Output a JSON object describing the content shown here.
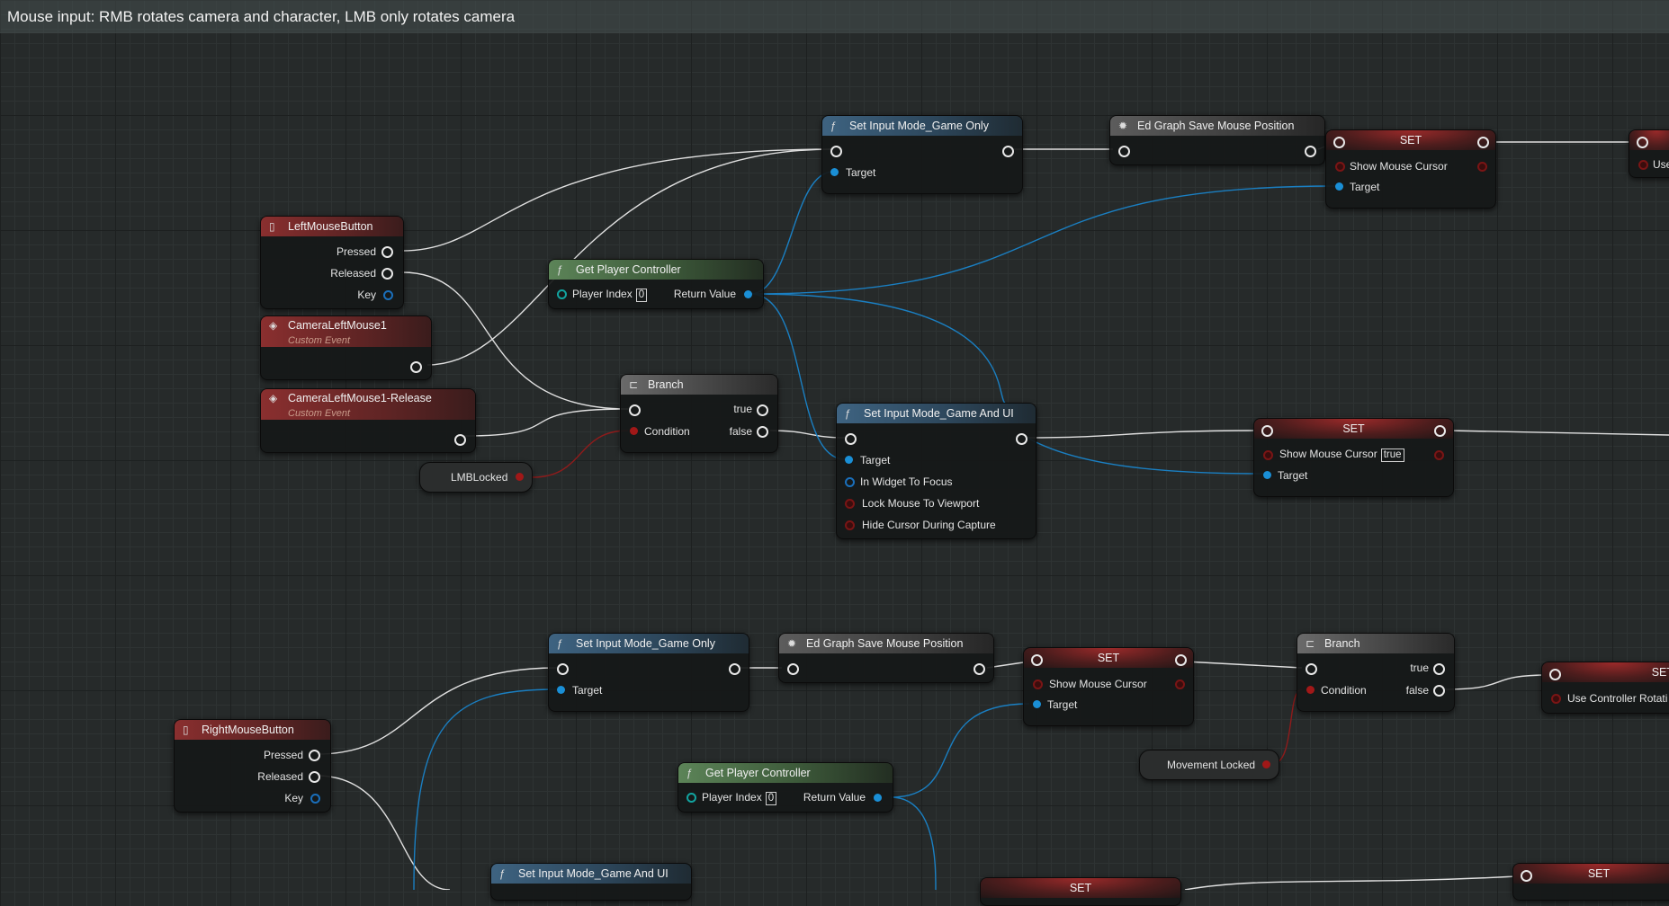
{
  "comment": "Mouse input: RMB rotates camera and character, LMB only rotates camera",
  "nodes": {
    "si_go_1": {
      "title": "Set Input Mode_Game Only",
      "target": "Target"
    },
    "ed_save_1": {
      "title": "Ed Graph Save Mouse Position"
    },
    "set_1": {
      "title": "SET",
      "var": "Show Mouse Cursor",
      "target": "Target"
    },
    "set_1b": {
      "label": "Use"
    },
    "lmb": {
      "title": "LeftMouseButton",
      "pressed": "Pressed",
      "released": "Released",
      "key": "Key"
    },
    "gpc_1": {
      "title": "Get Player Controller",
      "index_label": "Player Index",
      "index_value": "0",
      "return": "Return Value"
    },
    "cam_evt": {
      "title": "CameraLeftMouse1",
      "subtitle": "Custom Event"
    },
    "cam_rel": {
      "title": "CameraLeftMouse1-Release",
      "subtitle": "Custom Event"
    },
    "branch_1": {
      "title": "Branch",
      "true": "true",
      "false": "false",
      "condition": "Condition"
    },
    "lmb_locked": {
      "label": "LMBLocked"
    },
    "si_gui_1": {
      "title": "Set Input Mode_Game And UI",
      "target": "Target",
      "widget": "In Widget To Focus",
      "lock": "Lock Mouse To Viewport",
      "hide": "Hide Cursor During Capture"
    },
    "set_2": {
      "title": "SET",
      "var": "Show Mouse Cursor",
      "value": "true",
      "target": "Target"
    },
    "si_go_2": {
      "title": "Set Input Mode_Game Only",
      "target": "Target"
    },
    "ed_save_2": {
      "title": "Ed Graph Save Mouse Position"
    },
    "set_3": {
      "title": "SET",
      "var": "Show Mouse Cursor",
      "target": "Target"
    },
    "branch_2": {
      "title": "Branch",
      "true": "true",
      "false": "false",
      "condition": "Condition"
    },
    "set_4": {
      "title": "SET",
      "var": "Use Controller Rotati"
    },
    "movement_locked": {
      "label": "Movement Locked"
    },
    "rmb": {
      "title": "RightMouseButton",
      "pressed": "Pressed",
      "released": "Released",
      "key": "Key"
    },
    "gpc_2": {
      "title": "Get Player Controller",
      "index_label": "Player Index",
      "index_value": "0",
      "return": "Return Value"
    },
    "si_gui_2": {
      "title": "Set Input Mode_Game And UI"
    },
    "set_5": {
      "title": "SET"
    },
    "set_6": {
      "title": "SET"
    }
  },
  "colors": {
    "exec_wire": "#e0e0e0",
    "object_wire": "#1a8fd6",
    "bool_wire": "#8f1b1b",
    "function_header": "#3e6381",
    "pure_header": "#5c8458",
    "event_header": "#8a2f2f",
    "variable_header": "#9c2a2a"
  },
  "icons": {
    "function": "f-icon",
    "event": "diamond-icon",
    "mouse": "mouse-icon",
    "branch": "branch-icon",
    "editor": "gear-icon"
  }
}
